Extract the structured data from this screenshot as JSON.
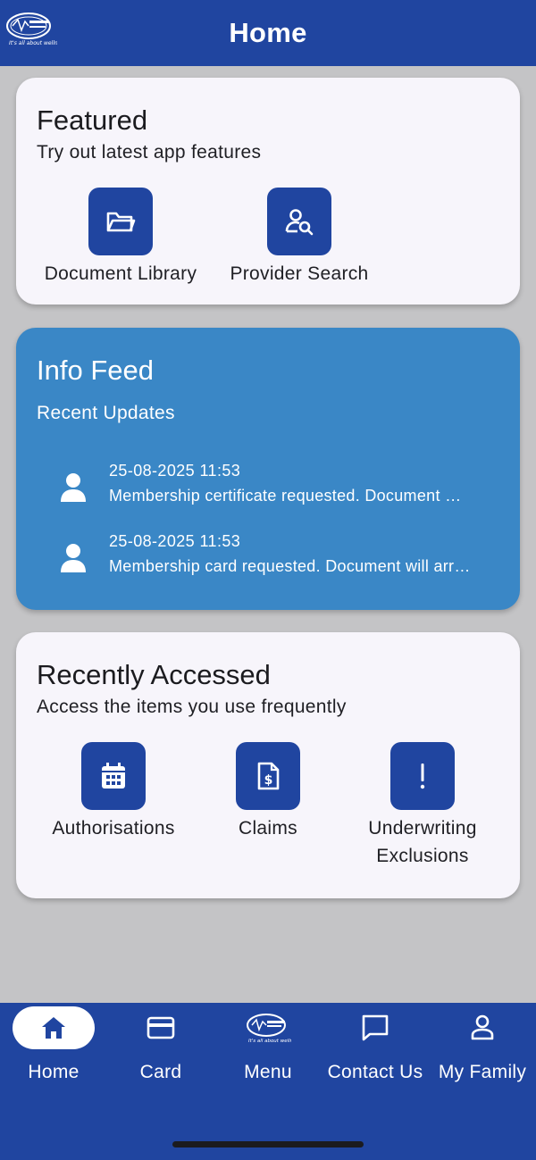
{
  "header": {
    "title": "Home",
    "logo_text": "BOTSOGO HEALTH PLAN",
    "logo_tagline": "It's all about wellness"
  },
  "featured": {
    "title": "Featured",
    "subtitle": "Try out latest app features",
    "items": [
      {
        "label": "Document Library",
        "icon": "folder-open-icon"
      },
      {
        "label": "Provider Search",
        "icon": "person-search-icon"
      }
    ]
  },
  "info_feed": {
    "title": "Info Feed",
    "subtitle": "Recent Updates",
    "items": [
      {
        "time": "25-08-2025 11:53",
        "text": "Membership certificate requested. Document will be sent to you shortly."
      },
      {
        "time": "25-08-2025 11:53",
        "text": "Membership card requested. Document will arrive shortly."
      }
    ]
  },
  "recent": {
    "title": "Recently Accessed",
    "subtitle": "Access the items you use frequently",
    "items": [
      {
        "label": "Authorisations",
        "icon": "calendar-icon"
      },
      {
        "label": "Claims",
        "icon": "dollar-document-icon"
      },
      {
        "label": "Underwriting Exclusions",
        "icon": "exclamation-icon"
      }
    ]
  },
  "nav": {
    "items": [
      {
        "label": "Home",
        "icon": "home-icon",
        "active": true
      },
      {
        "label": "Card",
        "icon": "card-icon",
        "active": false
      },
      {
        "label": "Menu",
        "icon": "logo-icon",
        "active": false
      },
      {
        "label": "Contact Us",
        "icon": "chat-icon",
        "active": false
      },
      {
        "label": "My Family",
        "icon": "person-icon",
        "active": false
      }
    ]
  },
  "colors": {
    "primary": "#2045a0",
    "info_card": "#3a87c6",
    "background": "#c4c4c6",
    "card": "#f7f5fb"
  }
}
